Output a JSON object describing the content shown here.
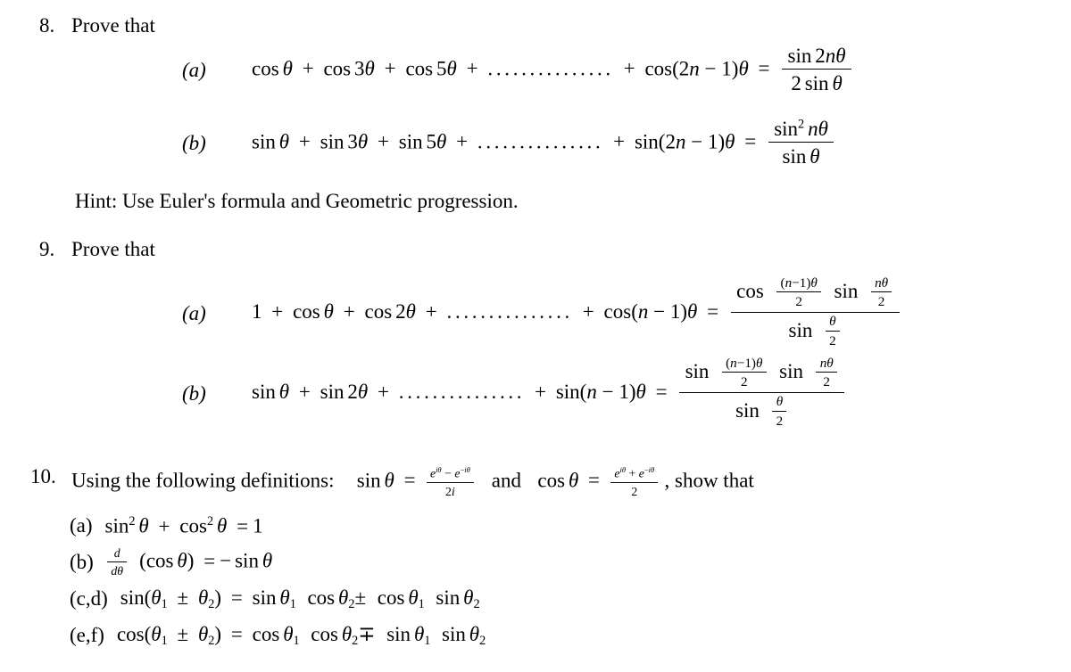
{
  "document": {
    "type": "math-exercise-sheet",
    "background_color": "#ffffff",
    "text_color": "#000000"
  },
  "problems": [
    {
      "number": "8.",
      "stem": "Prove that",
      "hint": "Hint: Use Euler's formula and Geometric progression.",
      "parts": [
        {
          "label": "(a)",
          "lhs_terms": [
            "cos θ",
            "cos 3θ",
            "cos 5θ"
          ],
          "ellipsis": "...............",
          "last_term": "cos(2n − 1)θ",
          "relation": "=",
          "rhs_numerator": "sin 2nθ",
          "rhs_denominator": "2 sin θ"
        },
        {
          "label": "(b)",
          "lhs_terms": [
            "sin θ",
            "sin 3θ",
            "sin 5θ"
          ],
          "ellipsis": "...............",
          "last_term": "sin(2n − 1)θ",
          "relation": "=",
          "rhs_numerator": "sin² nθ",
          "rhs_denominator": "sin θ"
        }
      ]
    },
    {
      "number": "9.",
      "stem": "Prove that",
      "parts": [
        {
          "label": "(a)",
          "lhs_terms": [
            "1",
            "cos θ",
            "cos 2θ"
          ],
          "ellipsis": "...............",
          "last_term": "cos(n − 1)θ",
          "relation": "=",
          "rhs_numerator": "cos ((n−1)θ)/2 · sin (nθ/2)",
          "rhs_denominator": "sin (θ/2)"
        },
        {
          "label": "(b)",
          "lhs_terms": [
            "sin θ",
            "sin 2θ"
          ],
          "ellipsis": "...............",
          "last_term": "sin(n − 1)θ",
          "relation": "=",
          "rhs_numerator": "sin ((n−1)θ)/2 · sin (nθ/2)",
          "rhs_denominator": "sin (θ/2)"
        }
      ]
    },
    {
      "number": "10.",
      "stem_lead": "Using the following definitions:",
      "definition_sin_lhs": "sin θ =",
      "definition_sin_numerator": "e^{iθ} − e^{−iθ}",
      "definition_sin_denominator": "2i",
      "definition_conjunction": "and",
      "definition_cos_lhs": "cos θ =",
      "definition_cos_numerator": "e^{iθ} + e^{−iθ}",
      "definition_cos_denominator": "2",
      "stem_tail": ",  show that",
      "items": [
        {
          "label": "(a)",
          "statement": "sin² θ + cos² θ = 1"
        },
        {
          "label": "(b)",
          "statement": "d/dθ (cos θ) = − sin θ"
        },
        {
          "label": "(c,d)",
          "statement": "sin(θ₁ ± θ₂) = sin θ₁ cos θ₂ ± cos θ₁ sin θ₂"
        },
        {
          "label": "(e,f)",
          "statement": "cos(θ₁ ± θ₂) = cos θ₁ cos θ₂ ∓ sin θ₁ sin θ₂"
        }
      ]
    }
  ],
  "symbols": {
    "theta": "θ",
    "plus_minus": "±",
    "minus_plus": "∓",
    "minus": "−",
    "equals": "=",
    "plus": "+",
    "dots": "...............",
    "dots_short": "..............."
  }
}
